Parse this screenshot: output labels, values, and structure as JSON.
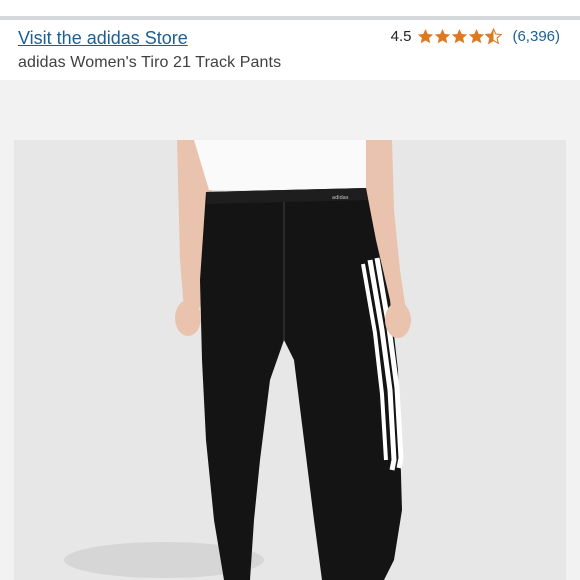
{
  "header": {
    "store_link": "Visit the adidas Store",
    "product_title": "adidas Women's Tiro 21 Track Pants"
  },
  "rating": {
    "value": "4.5",
    "stars": 4.5,
    "count": "(6,396)",
    "star_color": "#de7921"
  },
  "product_image": {
    "icon": "product-photo",
    "waistband_label": "adidas"
  }
}
